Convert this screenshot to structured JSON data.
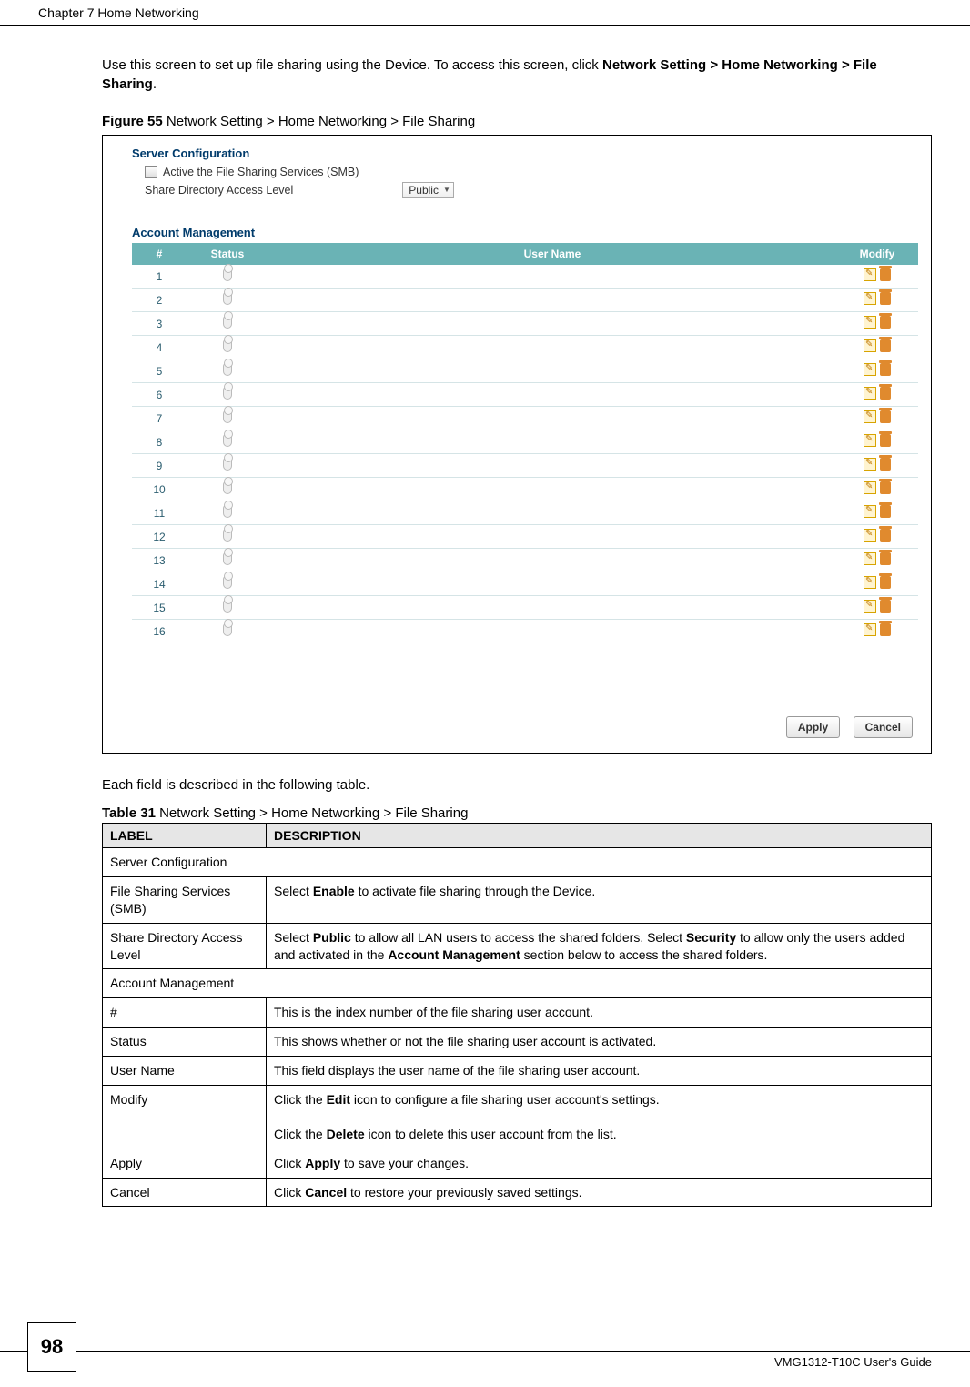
{
  "header": {
    "chapter": "Chapter 7 Home Networking"
  },
  "intro": {
    "line1a": "Use this screen to set up file sharing using the Device. To access this screen, click ",
    "line1b": "Network Setting > Home Networking > File Sharing",
    "line1c": "."
  },
  "figure": {
    "caption_bold": "Figure 55",
    "caption_rest": "   Network Setting > Home Networking > File Sharing"
  },
  "serverconf": {
    "title": "Server Configuration",
    "checkbox_label": "Active the File Sharing Services (SMB)",
    "level_label": "Share Directory Access Level",
    "level_value": "Public"
  },
  "acctmgmt": {
    "title": "Account Management",
    "headers": {
      "num": "#",
      "status": "Status",
      "user": "User Name",
      "modify": "Modify"
    },
    "rows": [
      {
        "n": "1"
      },
      {
        "n": "2"
      },
      {
        "n": "3"
      },
      {
        "n": "4"
      },
      {
        "n": "5"
      },
      {
        "n": "6"
      },
      {
        "n": "7"
      },
      {
        "n": "8"
      },
      {
        "n": "9"
      },
      {
        "n": "10"
      },
      {
        "n": "11"
      },
      {
        "n": "12"
      },
      {
        "n": "13"
      },
      {
        "n": "14"
      },
      {
        "n": "15"
      },
      {
        "n": "16"
      }
    ]
  },
  "buttons": {
    "apply": "Apply",
    "cancel": "Cancel"
  },
  "aftertext": "Each field is described in the following table.",
  "desc_table": {
    "caption_bold": "Table 31",
    "caption_rest": "   Network Setting > Home Networking > File Sharing",
    "head_label": "LABEL",
    "head_desc": "DESCRIPTION",
    "rows": [
      {
        "type": "section",
        "label": "Server Configuration"
      },
      {
        "type": "row",
        "label": "File Sharing Services (SMB)",
        "desc_pre": "Select ",
        "desc_b1": "Enable",
        "desc_post": " to activate file sharing through the Device."
      },
      {
        "type": "row",
        "label": "Share Directory Access Level",
        "desc": "share_dir"
      },
      {
        "type": "section",
        "label": "Account Management"
      },
      {
        "type": "row",
        "label": "#",
        "desc_plain": "This is the index number of the file sharing user account."
      },
      {
        "type": "row",
        "label": "Status",
        "desc_plain": "This shows whether or not the file sharing user account is activated."
      },
      {
        "type": "row",
        "label": "User Name",
        "desc_plain": "This field displays the user name of the file sharing user account."
      },
      {
        "type": "row",
        "label": "Modify",
        "desc": "modify"
      },
      {
        "type": "row",
        "label": "Apply",
        "desc_pre": "Click ",
        "desc_b1": "Apply",
        "desc_post": " to save your changes."
      },
      {
        "type": "row",
        "label": "Cancel",
        "desc_pre": "Click ",
        "desc_b1": "Cancel",
        "desc_post": " to restore your previously saved settings."
      }
    ],
    "share_dir": {
      "p1": "Select ",
      "b1": "Public",
      "p2": " to allow all LAN users to access the shared folders. Select ",
      "b2": "Security",
      "p3": " to allow only the users added and activated in the ",
      "b3": "Account Management",
      "p4": " section below to access the shared folders."
    },
    "modify": {
      "l1a": "Click the ",
      "l1b": "Edit",
      "l1c": " icon to configure a file sharing user account's settings.",
      "l2a": "Click the ",
      "l2b": "Delete",
      "l2c": " icon to delete this user account from the list."
    }
  },
  "footer": {
    "page": "98",
    "guide": "VMG1312-T10C User's Guide"
  }
}
